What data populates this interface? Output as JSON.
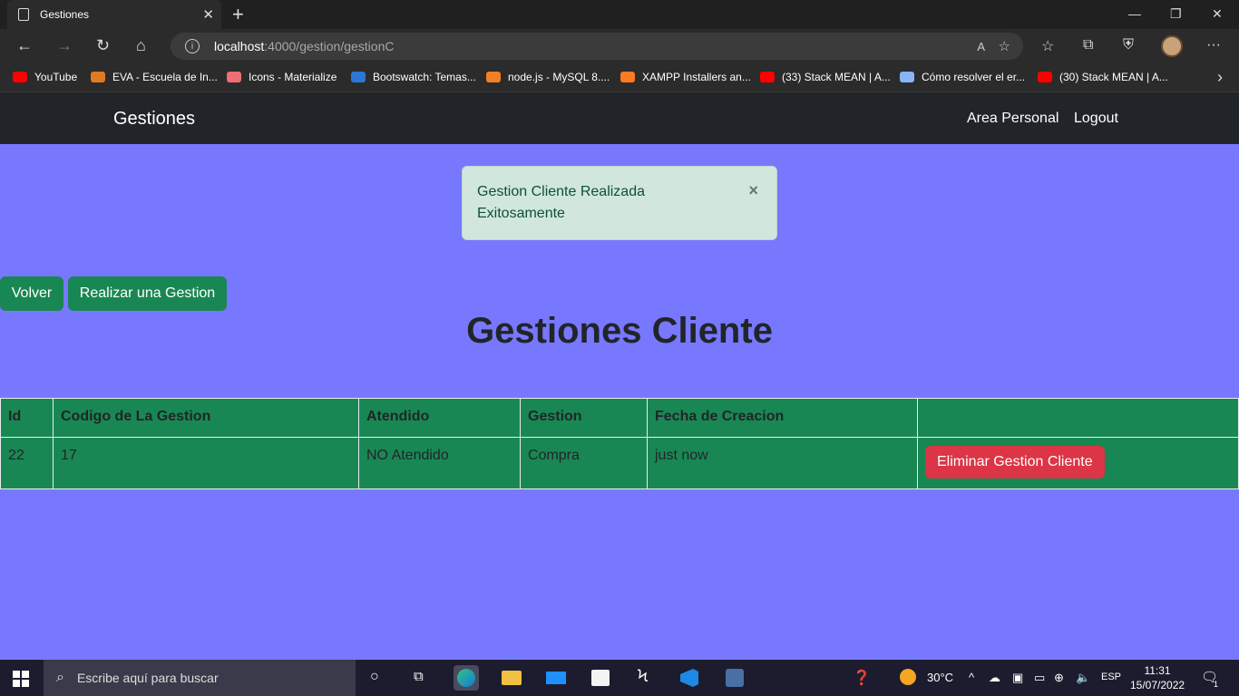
{
  "browser": {
    "tab_title": "Gestiones",
    "url_host": "localhost",
    "url_path": ":4000/gestion/gestionC",
    "bookmarks": [
      {
        "label": "YouTube",
        "color": "#ff0000"
      },
      {
        "label": "EVA - Escuela de In...",
        "color": "#e07b24"
      },
      {
        "label": "Icons - Materialize",
        "color": "#ee6e73"
      },
      {
        "label": "Bootswatch: Temas...",
        "color": "#2a78d6"
      },
      {
        "label": "node.js - MySQL 8....",
        "color": "#f48024"
      },
      {
        "label": "XAMPP Installers an...",
        "color": "#fb7a24"
      },
      {
        "label": "(33) Stack MEAN | A...",
        "color": "#ff0000"
      },
      {
        "label": "Cómo resolver el er...",
        "color": "#8ab4f8"
      },
      {
        "label": "(30) Stack MEAN | A...",
        "color": "#ff0000"
      }
    ]
  },
  "navbar": {
    "brand": "Gestiones",
    "links": [
      "Area Personal",
      "Logout"
    ]
  },
  "alert": {
    "message": "Gestion Cliente Realizada Exitosamente",
    "close": "×"
  },
  "buttons": {
    "back": "Volver",
    "new": "Realizar una Gestion"
  },
  "page_title": "Gestiones Cliente",
  "table": {
    "headers": [
      "Id",
      "Codigo de La Gestion",
      "Atendido",
      "Gestion",
      "Fecha de Creacion",
      ""
    ],
    "rows": [
      {
        "id": "22",
        "codigo": "17",
        "atendido": "NO Atendido",
        "gestion": "Compra",
        "fecha": "just now",
        "action": "Eliminar Gestion Cliente"
      }
    ]
  },
  "taskbar": {
    "search_placeholder": "Escribe aquí para buscar",
    "temperature": "30°C",
    "language": "ESP",
    "time": "11:31",
    "date": "15/07/2022",
    "notifications": "1"
  },
  "colors": {
    "page_bg": "#7878ff",
    "navbar_bg": "#212529",
    "success": "#198754",
    "danger": "#dc3545",
    "alert_bg": "#d1e7dd"
  }
}
